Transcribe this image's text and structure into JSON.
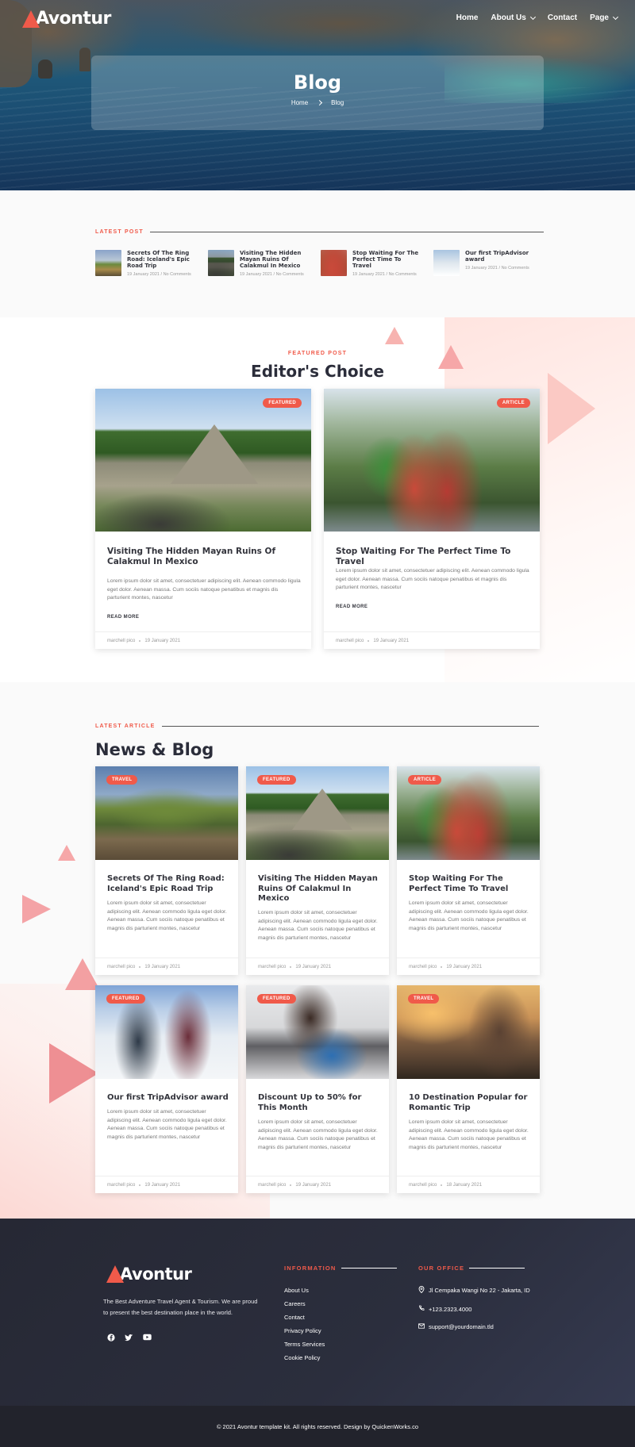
{
  "brand": {
    "name": "Avontur",
    "accent": "#f05a4a"
  },
  "nav": {
    "items": [
      {
        "label": "Home",
        "dropdown": false
      },
      {
        "label": "About Us",
        "dropdown": true
      },
      {
        "label": "Contact",
        "dropdown": false
      },
      {
        "label": "Page",
        "dropdown": true
      }
    ]
  },
  "hero": {
    "title": "Blog",
    "breadcrumb": [
      "Home",
      "Blog"
    ]
  },
  "latest_post": {
    "label": "LATEST POST",
    "items": [
      {
        "title": "Secrets Of The Ring Road: Iceland's Epic Road Trip",
        "date": "19 January 2021",
        "comments": "No Comments"
      },
      {
        "title": "Visiting The Hidden Mayan Ruins Of Calakmul In Mexico",
        "date": "19 January 2021",
        "comments": "No Comments"
      },
      {
        "title": "Stop Waiting For The Perfect Time To Travel",
        "date": "19 January 2021",
        "comments": "No Comments"
      },
      {
        "title": "Our first TripAdvisor award",
        "date": "19 January 2021",
        "comments": "No Comments"
      }
    ]
  },
  "editors": {
    "eyebrow": "FEATURED POST",
    "title": "Editor's Choice",
    "cards": [
      {
        "badge": "FEATURED",
        "title": "Visiting The Hidden Mayan Ruins Of Calakmul In Mexico",
        "excerpt": "Lorem ipsum dolor sit amet, consectetuer adipiscing elit. Aenean commodo ligula eget dolor. Aenean massa. Cum sociis natoque penatibus et magnis dis parturient montes, nascetur",
        "read_more": "READ MORE",
        "author": "marchell pico",
        "date": "19 January 2021"
      },
      {
        "badge": "ARTICLE",
        "title": "Stop Waiting For The Perfect Time To Travel",
        "excerpt": "Lorem ipsum dolor sit amet, consectetuer adipiscing elit. Aenean commodo ligula eget dolor. Aenean massa. Cum sociis natoque penatibus et magnis dis parturient montes, nascetur",
        "read_more": "READ MORE",
        "author": "marchell pico",
        "date": "19 January 2021"
      }
    ]
  },
  "news": {
    "eyebrow": "LATEST ARTICLE",
    "title": "News & Blog",
    "cards": [
      {
        "badge": "TRAVEL",
        "title": "Secrets Of The Ring Road: Iceland's Epic Road Trip",
        "excerpt": "Lorem ipsum dolor sit amet, consectetuer adipiscing elit. Aenean commodo ligula eget dolor. Aenean massa. Cum sociis natoque penatibus et magnis dis parturient montes, nascetur",
        "author": "marchell pico",
        "date": "19 January 2021"
      },
      {
        "badge": "FEATURED",
        "title": "Visiting The Hidden Mayan Ruins Of Calakmul In Mexico",
        "excerpt": "Lorem ipsum dolor sit amet, consectetuer adipiscing elit. Aenean commodo ligula eget dolor. Aenean massa. Cum sociis natoque penatibus et magnis dis parturient montes, nascetur",
        "author": "marchell pico",
        "date": "19 January 2021"
      },
      {
        "badge": "ARTICLE",
        "title": "Stop Waiting For The Perfect Time To Travel",
        "excerpt": "Lorem ipsum dolor sit amet, consectetuer adipiscing elit. Aenean commodo ligula eget dolor. Aenean massa. Cum sociis natoque penatibus et magnis dis parturient montes, nascetur",
        "author": "marchell pico",
        "date": "19 January 2021"
      },
      {
        "badge": "FEATURED",
        "title": "Our first TripAdvisor award",
        "excerpt": "Lorem ipsum dolor sit amet, consectetuer adipiscing elit. Aenean commodo ligula eget dolor. Aenean massa. Cum sociis natoque penatibus et magnis dis parturient montes, nascetur",
        "author": "marchell pico",
        "date": "19 January 2021"
      },
      {
        "badge": "FEATURED",
        "title": "Discount Up to 50% for This Month",
        "excerpt": "Lorem ipsum dolor sit amet, consectetuer adipiscing elit. Aenean commodo ligula eget dolor. Aenean massa. Cum sociis natoque penatibus et magnis dis parturient montes, nascetur",
        "author": "marchell pico",
        "date": "19 January 2021"
      },
      {
        "badge": "TRAVEL",
        "title": "10 Destination Popular for Romantic Trip",
        "excerpt": "Lorem ipsum dolor sit amet, consectetuer adipiscing elit. Aenean commodo ligula eget dolor. Aenean massa. Cum sociis natoque penatibus et magnis dis parturient montes, nascetur",
        "author": "marchell pico",
        "date": "18 January 2021"
      }
    ]
  },
  "footer": {
    "about": "The Best Adventure Travel Agent & Tourism. We are proud to present the best destination place in the world.",
    "social_icons": [
      "facebook-icon",
      "twitter-icon",
      "youtube-icon"
    ],
    "information_title": "INFORMATION",
    "links": [
      "About Us",
      "Careers",
      "Contact",
      "Privacy Policy",
      "Terms Services",
      "Cookie Policy"
    ],
    "office_title": "OUR OFFICE",
    "address": "Jl Cempaka Wangi No 22 - Jakarta, ID",
    "phone": "+123.2323.4000",
    "email": "support@yourdomain.tld",
    "copyright": "© 2021 Avontur template kit. All rights reserved. Design by QuickenWorks.co"
  }
}
